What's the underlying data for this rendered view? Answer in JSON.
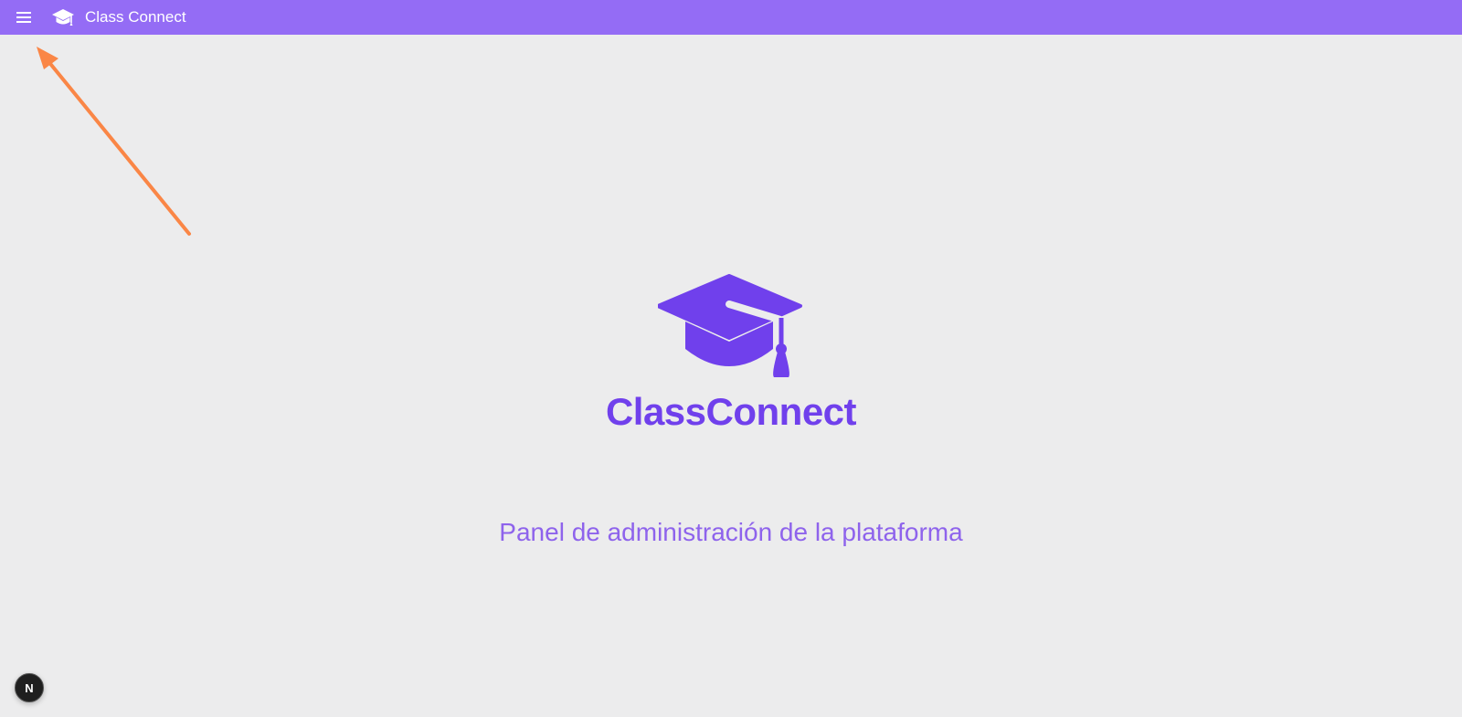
{
  "header": {
    "title": "Class Connect",
    "menu_icon": "hamburger-menu-icon",
    "logo_icon": "graduation-cap-icon",
    "background": "#946cf5",
    "text_color": "#ffffff"
  },
  "hero": {
    "logo_icon": "graduation-cap-icon",
    "brand": "ClassConnect",
    "brand_color": "#7040ec",
    "tagline": "Panel de administración de la plataforma",
    "tagline_color": "#8e63ec"
  },
  "annotation": {
    "type": "arrow",
    "color": "#fa8646",
    "points_to": "hamburger-menu-icon"
  },
  "dev_badge": {
    "label": "N"
  },
  "page": {
    "background": "#ececed"
  }
}
